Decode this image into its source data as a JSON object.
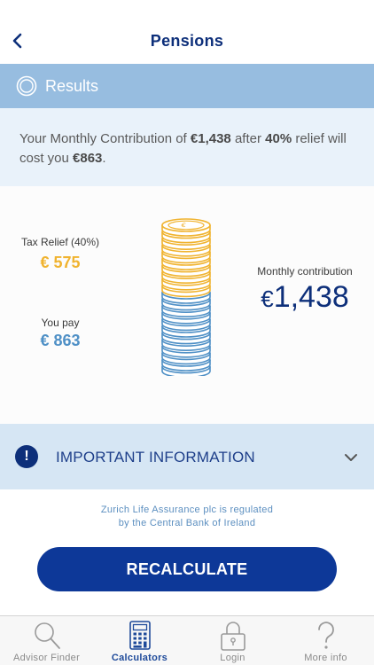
{
  "nav": {
    "title": "Pensions"
  },
  "results": {
    "label": "Results"
  },
  "summary": {
    "part1": "Your Monthly Contribution of ",
    "contribution": "€1,438",
    "part2": " after ",
    "relief_pct": "40%",
    "part3": " relief will cost you ",
    "cost": "€863",
    "part4": "."
  },
  "graphic": {
    "tax_relief_label": "Tax Relief (40%)",
    "tax_relief_value": "€ 575",
    "you_pay_label": "You pay",
    "you_pay_value": "€ 863",
    "monthly_label": "Monthly contribution",
    "monthly_currency": "€",
    "monthly_value": "1,438",
    "coin_icon": "euro-coin-stack",
    "colors": {
      "tax_relief": "#f0b32f",
      "you_pay": "#4f90c6"
    }
  },
  "important": {
    "label": "IMPORTANT INFORMATION",
    "icon": "exclamation"
  },
  "regulatory": {
    "line1": "Zurich Life Assurance plc is regulated",
    "line2": "by the Central Bank of Ireland"
  },
  "recalculate": {
    "label": "RECALCULATE"
  },
  "tabs": [
    {
      "label": "Advisor Finder",
      "icon": "search-icon"
    },
    {
      "label": "Calculators",
      "icon": "calculator-icon",
      "active": true
    },
    {
      "label": "Login",
      "icon": "lock-icon"
    },
    {
      "label": "More info",
      "icon": "question-icon"
    }
  ],
  "colors": {
    "brand_navy": "#0d2f7a",
    "button_blue": "#0d3898",
    "header_blue": "#97bde0"
  }
}
